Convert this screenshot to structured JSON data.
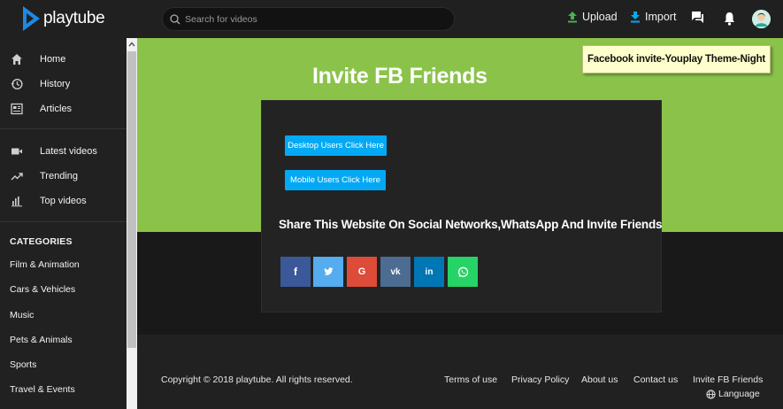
{
  "header": {
    "logo_text": "playtube",
    "search_placeholder": "Search for videos",
    "upload_label": "Upload",
    "import_label": "Import",
    "colors": {
      "accent": "#03a9f4",
      "upload_icon": "#4caf50"
    }
  },
  "sidebar": {
    "nav": [
      {
        "label": "Home",
        "icon": "home-icon"
      },
      {
        "label": "History",
        "icon": "history-icon"
      },
      {
        "label": "Articles",
        "icon": "articles-icon"
      }
    ],
    "nav2": [
      {
        "label": "Latest videos",
        "icon": "video-camera-icon"
      },
      {
        "label": "Trending",
        "icon": "trending-icon"
      },
      {
        "label": "Top videos",
        "icon": "bar-chart-icon"
      }
    ],
    "categories_title": "CATEGORIES",
    "categories": [
      "Film & Animation",
      "Cars & Vehicles",
      "Music",
      "Pets & Animals",
      "Sports",
      "Travel & Events"
    ]
  },
  "main": {
    "hero_title": "Invite FB Friends",
    "tooltip": "Facebook invite-Youplay Theme-Night",
    "desktop_button": "Desktop Users Click Here",
    "mobile_button": "Mobile Users Click Here",
    "share_title": "Share This Website On Social Networks,WhatsApp And Invite Friends",
    "social": [
      {
        "name": "facebook",
        "glyph": "f",
        "color": "#3b5998"
      },
      {
        "name": "twitter",
        "glyph": "t",
        "color": "#55acee"
      },
      {
        "name": "google",
        "glyph": "G",
        "color": "#dd4b39"
      },
      {
        "name": "vk",
        "glyph": "vk",
        "color": "#4c6c91"
      },
      {
        "name": "linkedin",
        "glyph": "in",
        "color": "#0077b5"
      },
      {
        "name": "whatsapp",
        "glyph": "W",
        "color": "#25d366"
      }
    ],
    "hero_color": "#8bc34a"
  },
  "footer": {
    "copyright": "Copyright © 2018 playtube. All rights reserved.",
    "links": [
      "Terms of use",
      "Privacy Policy",
      "About us",
      "Contact us",
      "Invite FB Friends"
    ],
    "language": "Language"
  }
}
